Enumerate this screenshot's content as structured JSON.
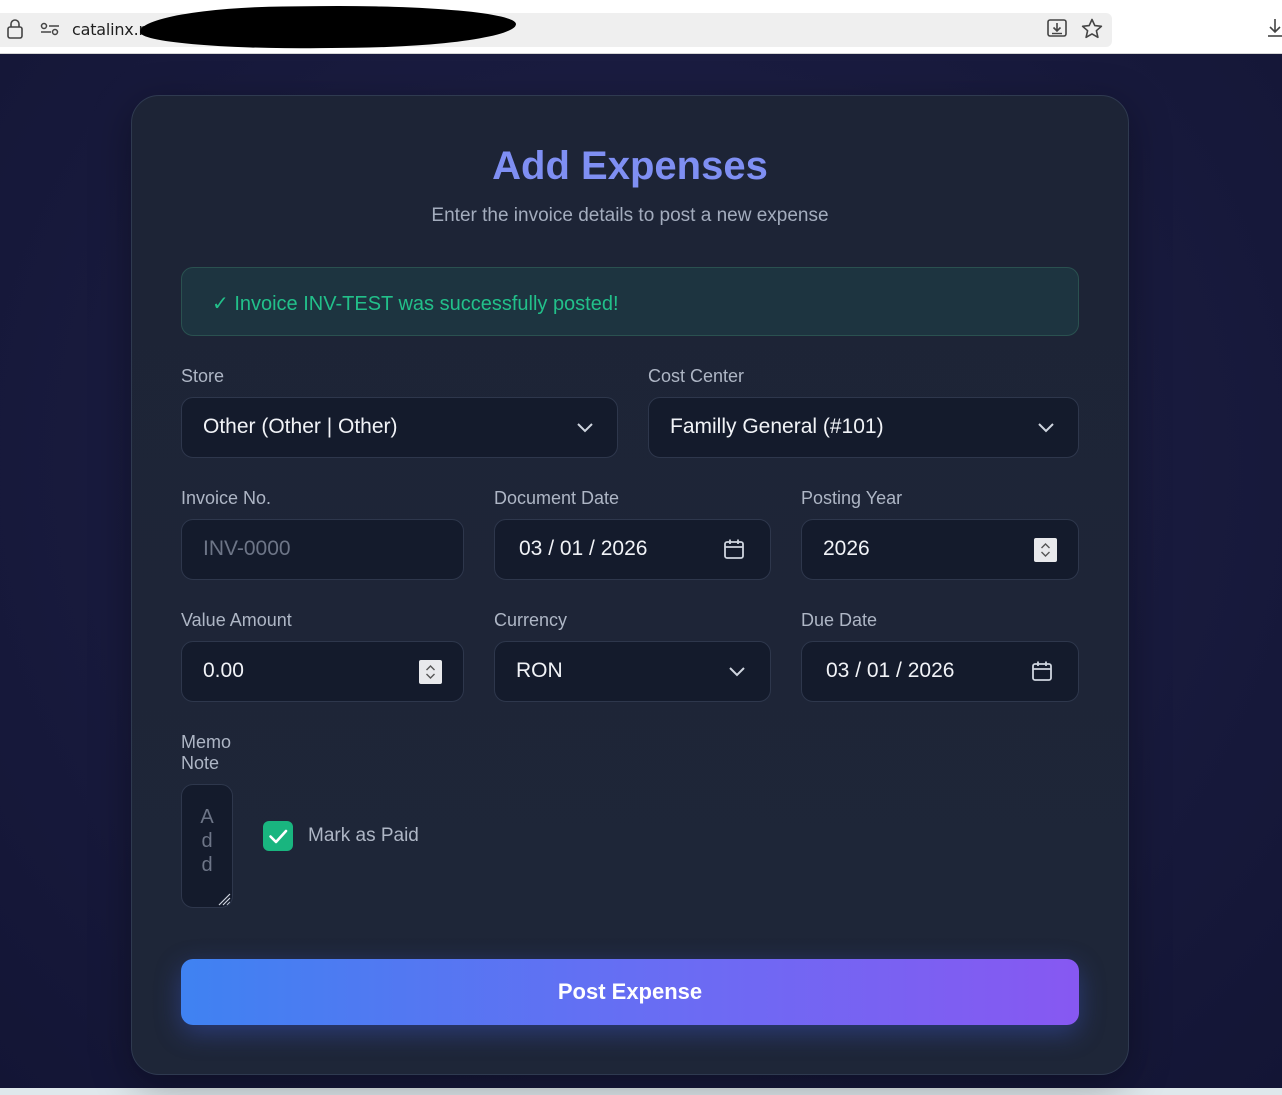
{
  "browser": {
    "url": "catalinx.ro"
  },
  "page": {
    "title": "Add Expenses",
    "subtitle": "Enter the invoice details to post a new expense",
    "success_message": "✓ Invoice INV-TEST was successfully posted!"
  },
  "form": {
    "store": {
      "label": "Store",
      "value": "Other (Other | Other)"
    },
    "cost_center": {
      "label": "Cost Center",
      "value": "Familly General (#101)"
    },
    "invoice_no": {
      "label": "Invoice No.",
      "placeholder": "INV-0000"
    },
    "document_date": {
      "label": "Document Date",
      "value": "03 / 01 / 2026"
    },
    "posting_year": {
      "label": "Posting Year",
      "value": "2026"
    },
    "value_amount": {
      "label": "Value Amount",
      "value": "0.00"
    },
    "currency": {
      "label": "Currency",
      "value": "RON"
    },
    "due_date": {
      "label": "Due Date",
      "value": "03 / 01 / 2026"
    },
    "memo": {
      "label_line1": "Memo",
      "label_line2": "Note",
      "placeholder": "Add"
    },
    "mark_as_paid": {
      "label": "Mark as Paid",
      "checked": true
    },
    "submit_label": "Post Expense"
  },
  "colors": {
    "title": "#7f8ff3",
    "success": "#22c08a",
    "checkbox": "#19b57f",
    "button_start": "#3f82f2",
    "button_end": "#8758f2"
  }
}
